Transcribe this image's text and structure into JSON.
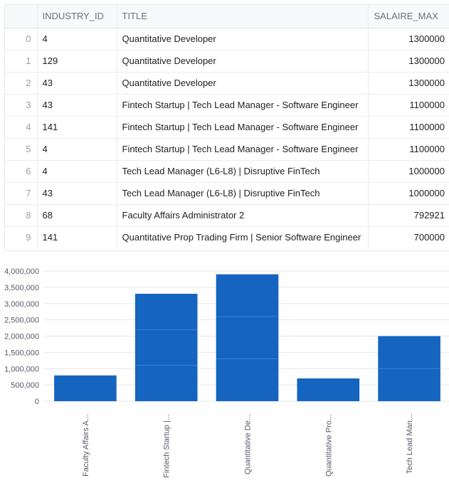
{
  "table": {
    "columns": [
      "",
      "INDUSTRY_ID",
      "TITLE",
      "SALAIRE_MAX"
    ],
    "rows": [
      {
        "index": "0",
        "industry_id": "4",
        "title": "Quantitative Developer",
        "salaire_max": "1300000"
      },
      {
        "index": "1",
        "industry_id": "129",
        "title": "Quantitative Developer",
        "salaire_max": "1300000"
      },
      {
        "index": "2",
        "industry_id": "43",
        "title": "Quantitative Developer",
        "salaire_max": "1300000"
      },
      {
        "index": "3",
        "industry_id": "43",
        "title": "Fintech Startup | Tech Lead Manager - Software Engineer",
        "salaire_max": "1100000"
      },
      {
        "index": "4",
        "industry_id": "141",
        "title": "Fintech Startup | Tech Lead Manager - Software Engineer",
        "salaire_max": "1100000"
      },
      {
        "index": "5",
        "industry_id": "4",
        "title": "Fintech Startup | Tech Lead Manager - Software Engineer",
        "salaire_max": "1100000"
      },
      {
        "index": "6",
        "industry_id": "4",
        "title": "Tech Lead Manager (L6-L8) | Disruptive FinTech",
        "salaire_max": "1000000"
      },
      {
        "index": "7",
        "industry_id": "43",
        "title": "Tech Lead Manager (L6-L8) | Disruptive FinTech",
        "salaire_max": "1000000"
      },
      {
        "index": "8",
        "industry_id": "68",
        "title": "Faculty Affairs Administrator 2",
        "salaire_max": "792921"
      },
      {
        "index": "9",
        "industry_id": "141",
        "title": "Quantitative Prop Trading Firm | Senior Software Engineer",
        "salaire_max": "700000"
      }
    ]
  },
  "chart_data": {
    "type": "bar",
    "stacked": true,
    "color": "#1565c0",
    "categories": [
      "Faculty Affairs A...",
      "Fintech Startup |...",
      "Quantitative De...",
      "Quantitative Pro...",
      "Tech Lead Man..."
    ],
    "segments": [
      [
        792921
      ],
      [
        1100000,
        1100000,
        1100000
      ],
      [
        1300000,
        1300000,
        1300000
      ],
      [
        700000
      ],
      [
        1000000,
        1000000
      ]
    ],
    "values": [
      792921,
      3300000,
      3900000,
      700000,
      2000000
    ],
    "ylim": [
      0,
      4000000
    ],
    "y_ticks": [
      "0",
      "500,000",
      "1,000,000",
      "1,500,000",
      "2,000,000",
      "2,500,000",
      "3,000,000",
      "3,500,000",
      "4,000,000"
    ],
    "y_tick_values": [
      0,
      500000,
      1000000,
      1500000,
      2000000,
      2500000,
      3000000,
      3500000,
      4000000
    ],
    "grid": true
  }
}
